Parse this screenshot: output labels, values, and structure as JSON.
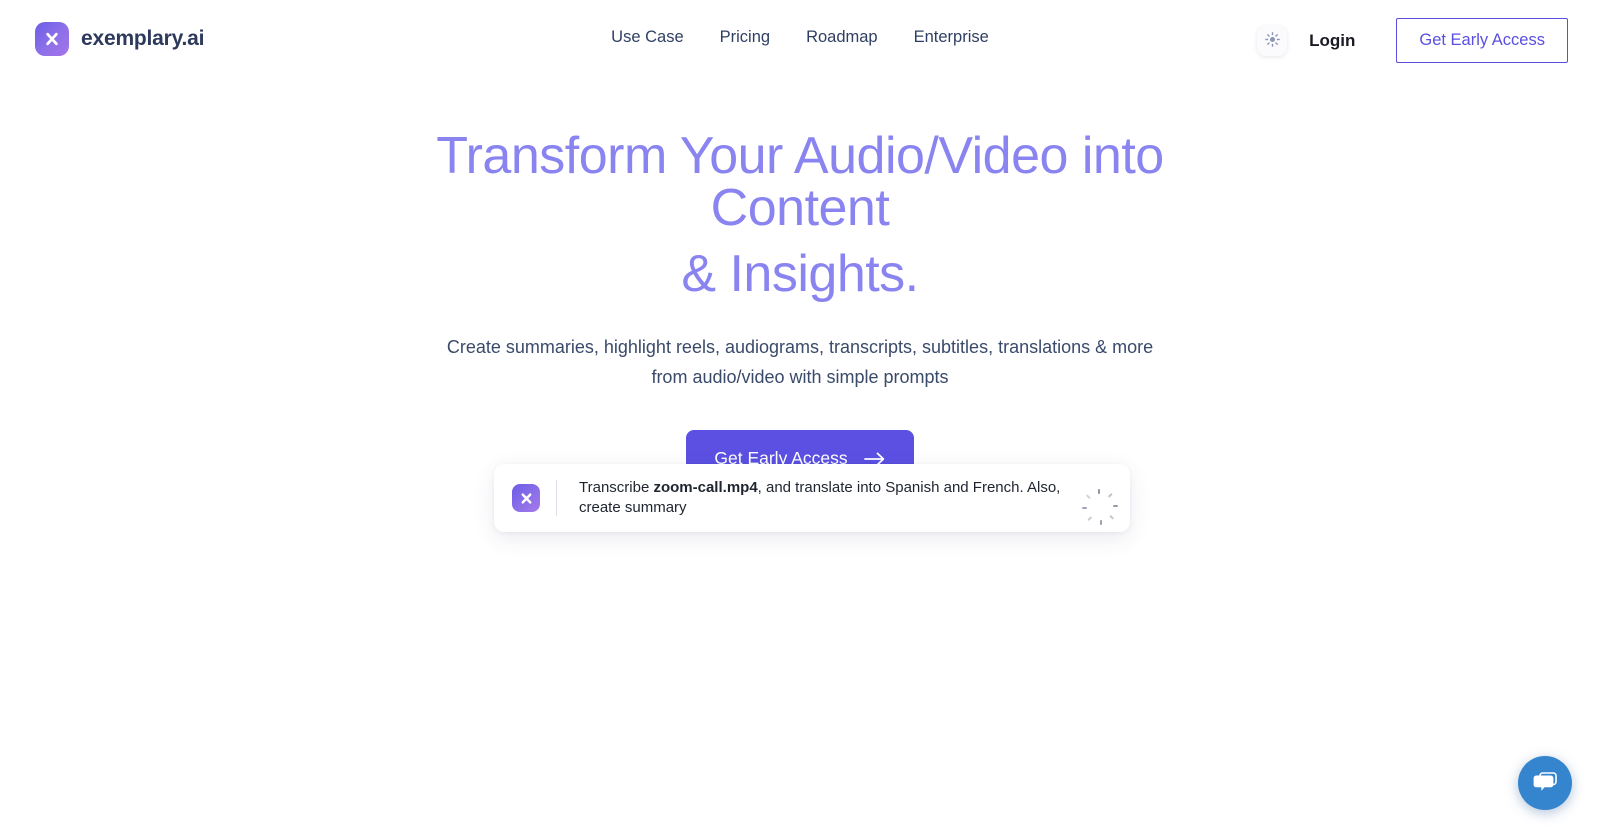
{
  "brand": {
    "name": "exemplary.ai",
    "logo_icon": "x-logo-icon"
  },
  "nav": {
    "items": [
      {
        "label": "Use Case"
      },
      {
        "label": "Pricing"
      },
      {
        "label": "Roadmap"
      },
      {
        "label": "Enterprise"
      }
    ]
  },
  "header": {
    "theme_toggle_icon": "sun-icon",
    "login_label": "Login",
    "cta_label": "Get Early Access"
  },
  "hero": {
    "title_line1": "Transform Your Audio/Video into Content",
    "title_line2": "& Insights.",
    "subtitle": "Create summaries, highlight reels, audiograms, transcripts, subtitles, translations & more from audio/video with simple prompts",
    "cta_label": "Get Early Access",
    "cta_icon": "arrow-right-icon"
  },
  "prompt_card": {
    "logo_icon": "x-logo-icon",
    "text_before": "Transcribe ",
    "filename": "zoom-call.mp4",
    "text_after": ", and translate into Spanish and French. Also, create summary",
    "status_icon": "loading-spinner-icon"
  },
  "chat_widget": {
    "icon": "chat-bubbles-icon"
  },
  "colors": {
    "accent_purple": "#5b50e2",
    "heading_purple": "#8a84f0",
    "navy_text": "#2f3f63",
    "chat_blue": "#3585ce",
    "page_background": "#ffffff"
  }
}
